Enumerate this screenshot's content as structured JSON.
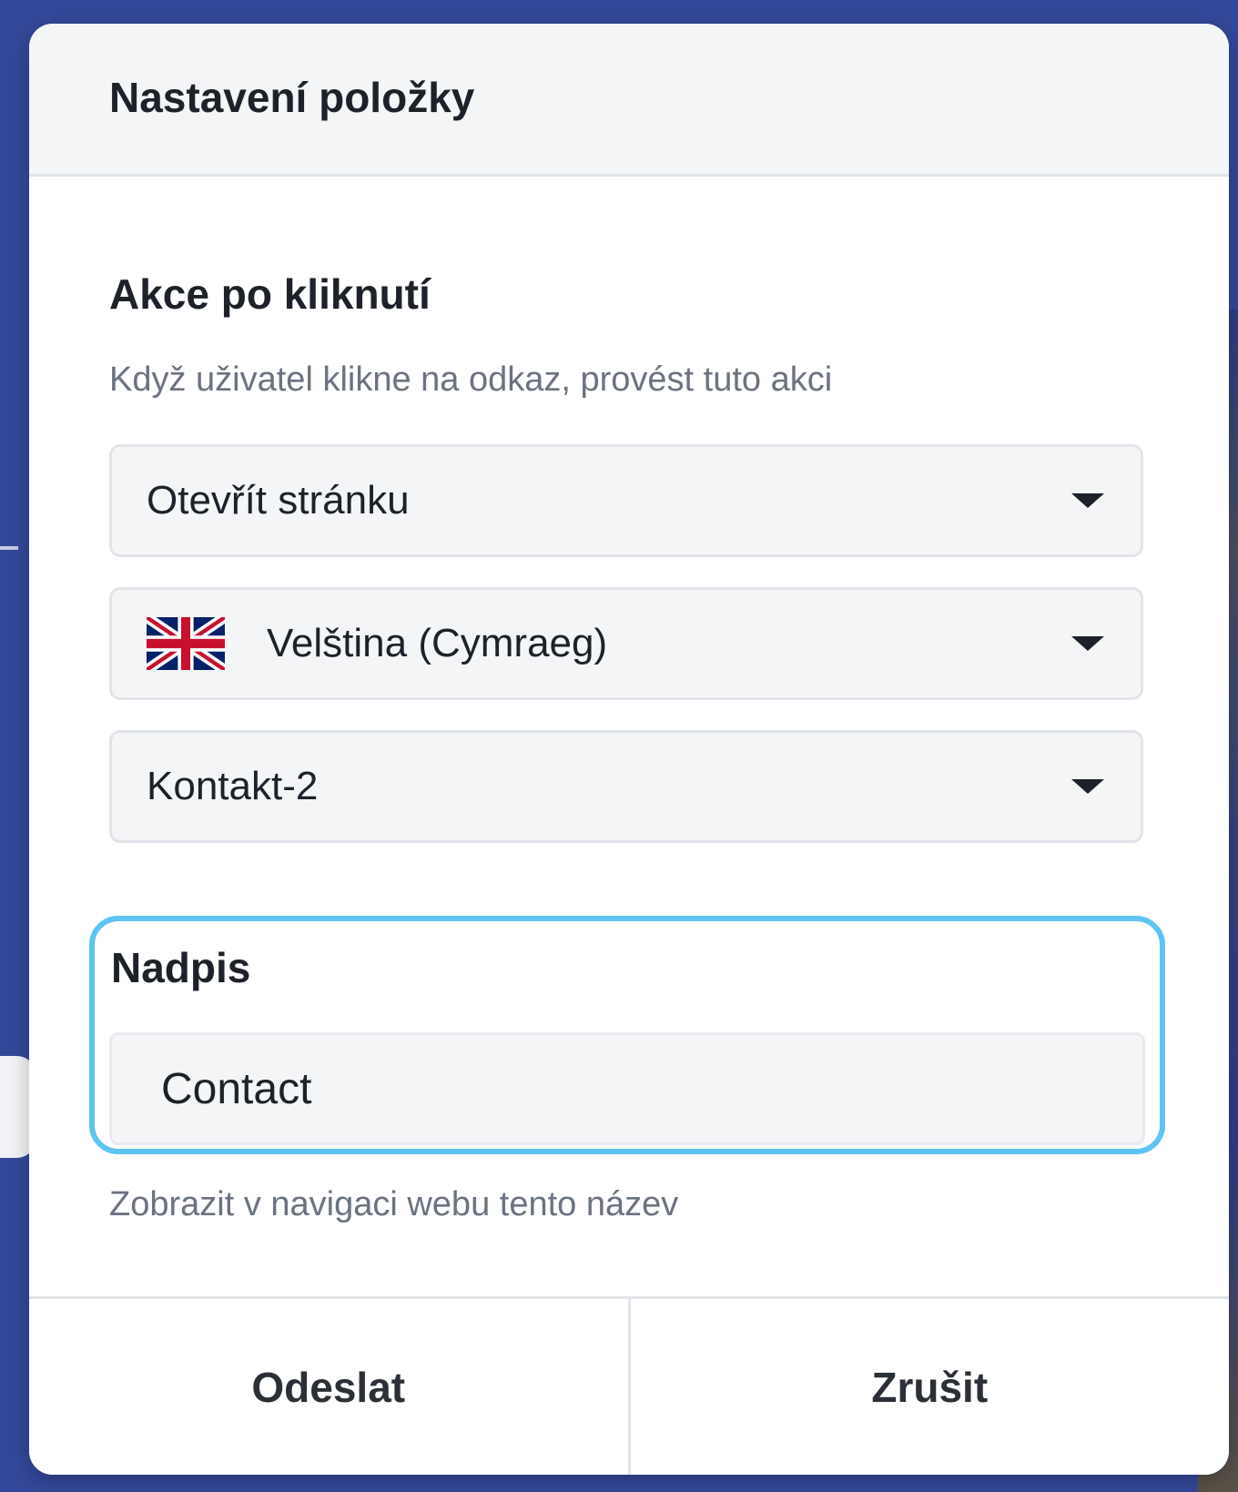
{
  "dialog": {
    "title": "Nastavení položky"
  },
  "click_action": {
    "title": "Akce po kliknutí",
    "description": "Když uživatel klikne na odkaz, provést tuto akci",
    "action_select": {
      "value": "Otevřít stránku",
      "icon": "chevron-down-icon"
    },
    "language_select": {
      "value": "Velština (Cymraeg)",
      "flag_icon": "uk-flag-icon",
      "icon": "chevron-down-icon"
    },
    "page_select": {
      "value": "Kontakt-2",
      "icon": "chevron-down-icon"
    }
  },
  "caption": {
    "label": "Nadpis",
    "value": "Contact",
    "help": "Zobrazit v navigaci webu tento název",
    "focus_color": "#5ec4f2"
  },
  "footer": {
    "submit_label": "Odeslat",
    "cancel_label": "Zrušit"
  },
  "colors": {
    "backdrop": "#34489a",
    "text_primary": "#1d2129",
    "text_secondary": "#6b7280"
  }
}
